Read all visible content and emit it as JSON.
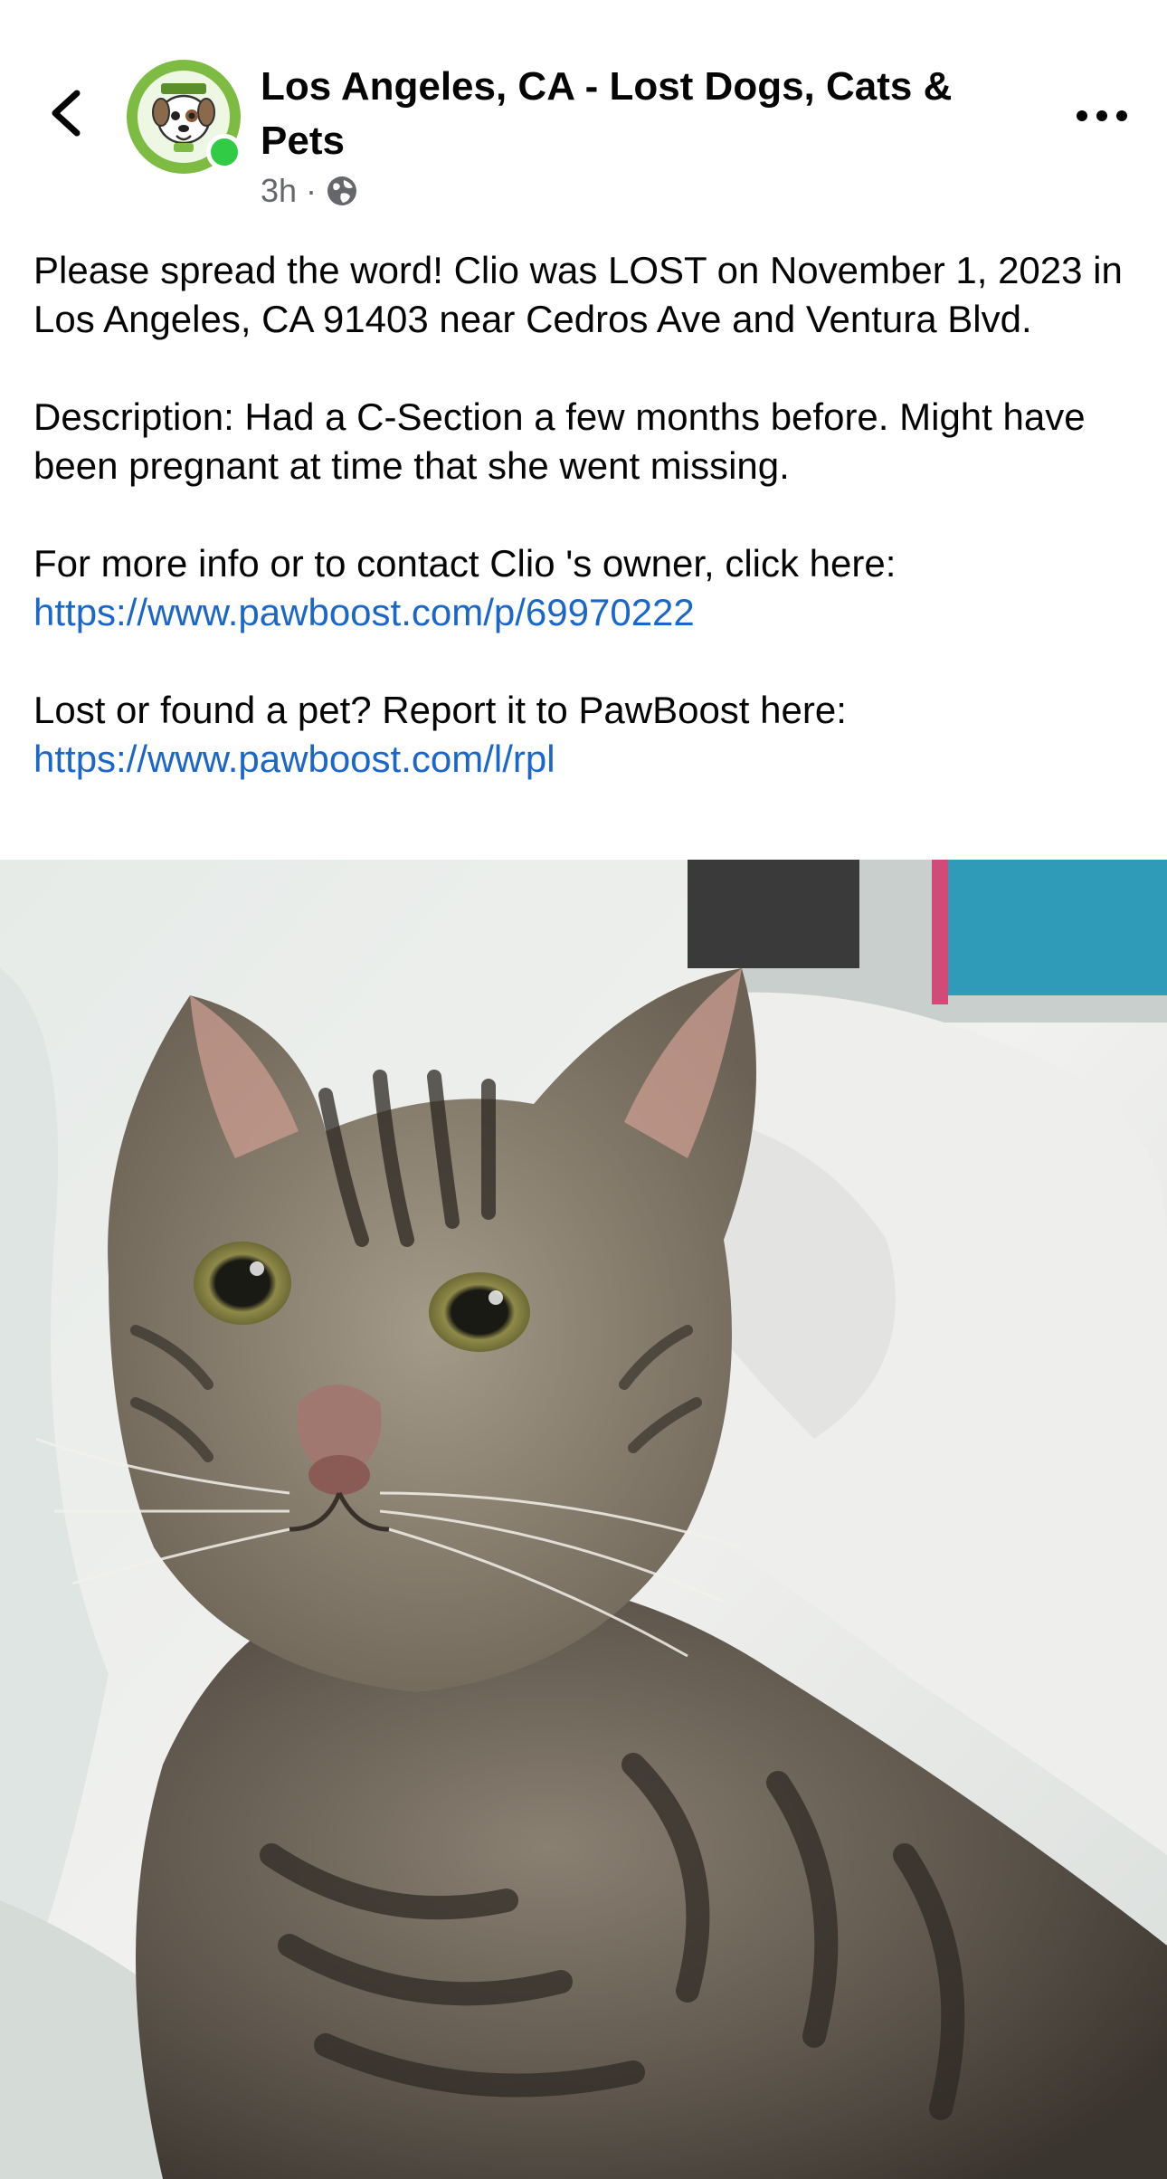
{
  "header": {
    "group_name": "Los Angeles, CA - Lost Dogs, Cats & Pets",
    "time_ago": "3h",
    "separator": "·",
    "audience_icon": "globe-icon",
    "back_icon": "chevron-left-icon",
    "more_icon": "more-horizontal-icon",
    "online_color": "#31cc46"
  },
  "post": {
    "p1": "Please spread the word! Clio  was LOST on November 1, 2023 in Los Angeles, CA 91403 near Cedros Ave and Ventura Blvd.",
    "p2": "Description: Had a C-Section a few months before. Might have been pregnant at time that she went missing.",
    "p3_text": "For more info or to contact Clio 's owner, click here: ",
    "p3_link": "https://www.pawboost.com/p/69970222",
    "p4_text": "Lost or found a pet? Report it to PawBoost here: ",
    "p4_link": "https://www.pawboost.com/l/rpl",
    "link_color": "#1b66c9"
  },
  "photo": {
    "subject": "tabby cat lying on white blanket"
  }
}
